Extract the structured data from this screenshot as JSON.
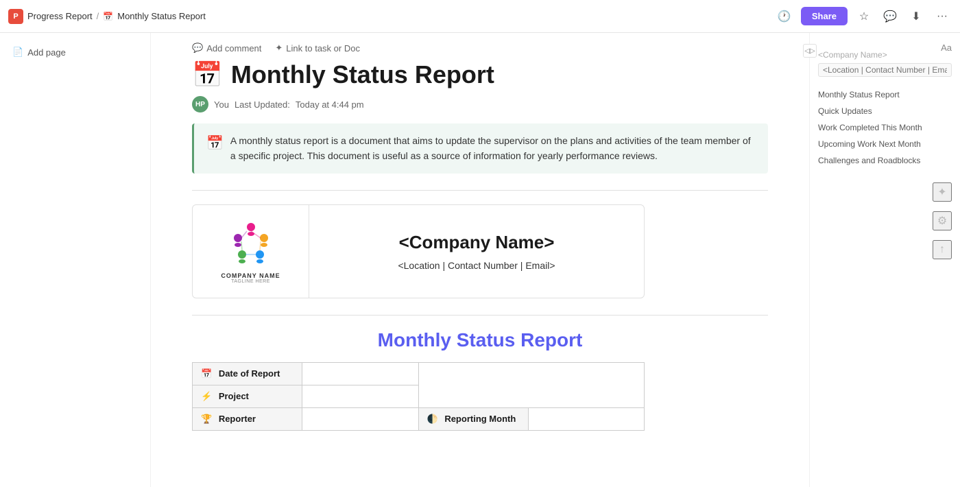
{
  "app": {
    "name": "Progress Report",
    "icon": "P"
  },
  "topbar": {
    "breadcrumb_app": "Progress Report",
    "breadcrumb_sep": "/",
    "doc_emoji": "📅",
    "doc_name": "Monthly Status Report",
    "share_label": "Share",
    "font_size_label": "Aa"
  },
  "sidebar": {
    "add_page_label": "Add page"
  },
  "actions": {
    "comment_label": "Add comment",
    "link_label": "Link to task or Doc"
  },
  "page": {
    "title_emoji": "📅",
    "title": "Monthly Status Report",
    "author_avatar": "HP",
    "author_name": "You",
    "last_updated_label": "Last Updated:",
    "last_updated_value": "Today at 4:44 pm",
    "callout_icon": "📅",
    "callout_text": "A monthly status report is a document that aims to update the supervisor on the plans and activities of the team member of a specific project. This document is useful as a source of information for yearly performance reviews."
  },
  "company": {
    "name_placeholder": "<Company Name>",
    "details_placeholder": "<Location | Contact Number | Email>",
    "logo_name": "COMPANY NAME",
    "logo_tagline": "TAGLINE HERE"
  },
  "report": {
    "section_title": "Monthly Status Report",
    "table_rows": [
      {
        "icon": "📅",
        "label": "Date of Report",
        "value": ""
      },
      {
        "icon": "⚡",
        "label": "Project",
        "value": ""
      },
      {
        "icon": "🏆",
        "label": "Reporter",
        "value": ""
      }
    ],
    "reporting_month_label": "Reporting Month",
    "reporting_month_icon": "🌓"
  },
  "outline": {
    "company_name_placeholder": "<Company Name>",
    "contact_placeholder": "<Location | Contact Number | Email>",
    "items": [
      {
        "label": "Monthly Status Report",
        "sub": false
      },
      {
        "label": "Quick Updates",
        "sub": false
      },
      {
        "label": "Work Completed This Month",
        "sub": false
      },
      {
        "label": "Upcoming Work Next Month",
        "sub": false
      },
      {
        "label": "Challenges and Roadblocks",
        "sub": false
      }
    ]
  }
}
